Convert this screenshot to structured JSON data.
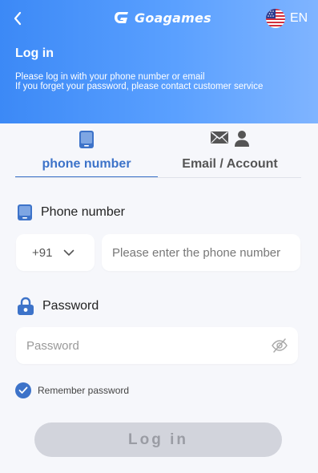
{
  "header": {
    "brand": "Goagames",
    "language": "EN",
    "title": "Log in",
    "subtitle_line1": "Please log in with your phone number or email",
    "subtitle_line2": "If you forget your password, please contact customer service"
  },
  "tabs": [
    {
      "label": "phone number",
      "icon": "phone-icon",
      "active": true
    },
    {
      "label": "Email / Account",
      "icon": "mail-user-icon",
      "active": false
    }
  ],
  "phone": {
    "label": "Phone number",
    "country_code": "+91",
    "placeholder": "Please enter the phone number",
    "value": ""
  },
  "password": {
    "label": "Password",
    "placeholder": "Password",
    "value": ""
  },
  "remember": {
    "label": "Remember password",
    "checked": true
  },
  "login_button": "Log in",
  "colors": {
    "header_gradient": [
      "#3c89f6",
      "#7fb4ff"
    ],
    "accent": "#3d73c9",
    "background": "#f6f7fb",
    "button_disabled": "#d2d4dc"
  }
}
